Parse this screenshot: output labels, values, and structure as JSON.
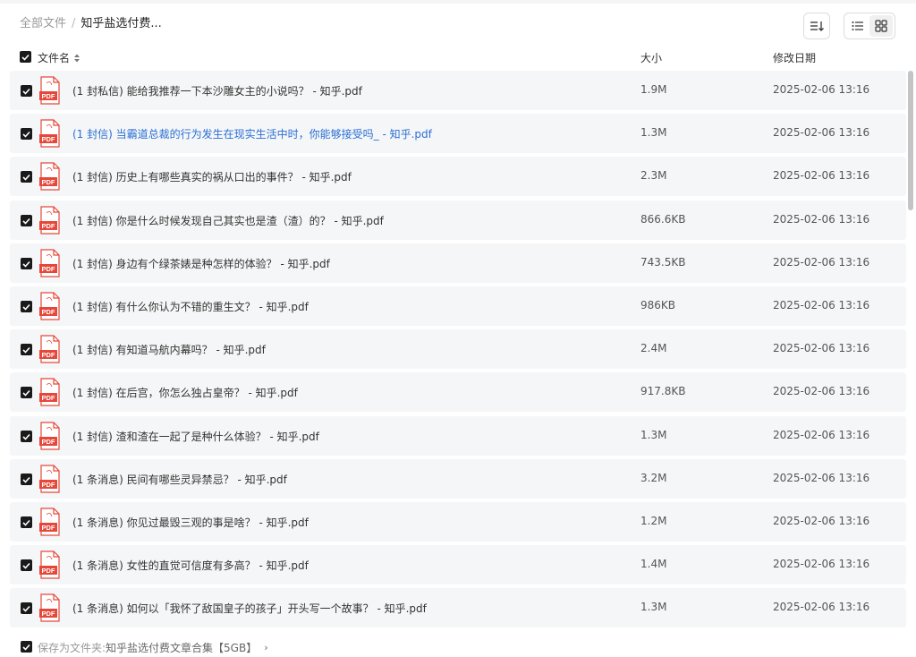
{
  "breadcrumb": {
    "root": "全部文件",
    "separator": "/",
    "current": "知乎盐选付费..."
  },
  "columns": {
    "name": "文件名",
    "size": "大小",
    "date": "修改日期"
  },
  "icons": {
    "sort": "sort-lines-icon",
    "list_view": "list-view-icon",
    "grid_view": "grid-view-icon",
    "file": "pdf-file-icon",
    "name_sort": "sort-updown-icon"
  },
  "colors": {
    "highlight": "#2b6fd6",
    "pdf_red": "#e5483a",
    "checkbox": "#1a1a1a"
  },
  "files": [
    {
      "name": "(1 封私信) 能给我推荐一下本沙雕女主的小说吗？ - 知乎.pdf",
      "size": "1.9M",
      "date": "2025-02-06 13:16"
    },
    {
      "name": "(1 封信) 当霸道总裁的行为发生在现实生活中时，你能够接受吗_ - 知乎.pdf",
      "size": "1.3M",
      "date": "2025-02-06 13:16"
    },
    {
      "name": "(1 封信) 历史上有哪些真实的祸从口出的事件？ - 知乎.pdf",
      "size": "2.3M",
      "date": "2025-02-06 13:16"
    },
    {
      "name": "(1 封信) 你是什么时候发现自己其实也是渣（渣）的？ - 知乎.pdf",
      "size": "866.6KB",
      "date": "2025-02-06 13:16"
    },
    {
      "name": "(1 封信) 身边有个绿茶婊是种怎样的体验？ - 知乎.pdf",
      "size": "743.5KB",
      "date": "2025-02-06 13:16"
    },
    {
      "name": "(1 封信) 有什么你认为不错的重生文？ - 知乎.pdf",
      "size": "986KB",
      "date": "2025-02-06 13:16"
    },
    {
      "name": "(1 封信) 有知道马航内幕吗？ - 知乎.pdf",
      "size": "2.4M",
      "date": "2025-02-06 13:16"
    },
    {
      "name": "(1 封信) 在后宫，你怎么独占皇帝？ - 知乎.pdf",
      "size": "917.8KB",
      "date": "2025-02-06 13:16"
    },
    {
      "name": "(1 封信) 渣和渣在一起了是种什么体验？ - 知乎.pdf",
      "size": "1.3M",
      "date": "2025-02-06 13:16"
    },
    {
      "name": "(1 条消息) 民间有哪些灵异禁忌？ - 知乎.pdf",
      "size": "3.2M",
      "date": "2025-02-06 13:16"
    },
    {
      "name": "(1 条消息) 你见过最毁三观的事是啥？ - 知乎.pdf",
      "size": "1.2M",
      "date": "2025-02-06 13:16"
    },
    {
      "name": "(1 条消息) 女性的直觉可信度有多高？ - 知乎.pdf",
      "size": "1.4M",
      "date": "2025-02-06 13:16"
    },
    {
      "name": "(1 条消息) 如何以「我怀了敌国皇子的孩子」开头写一个故事？ - 知乎.pdf",
      "size": "1.3M",
      "date": "2025-02-06 13:16"
    }
  ],
  "footer": {
    "label": "保存为文件夹:",
    "folder": "知乎盐选付费文章合集【5GB】",
    "arrow": "›"
  },
  "pdf_icon_label": "PDF"
}
